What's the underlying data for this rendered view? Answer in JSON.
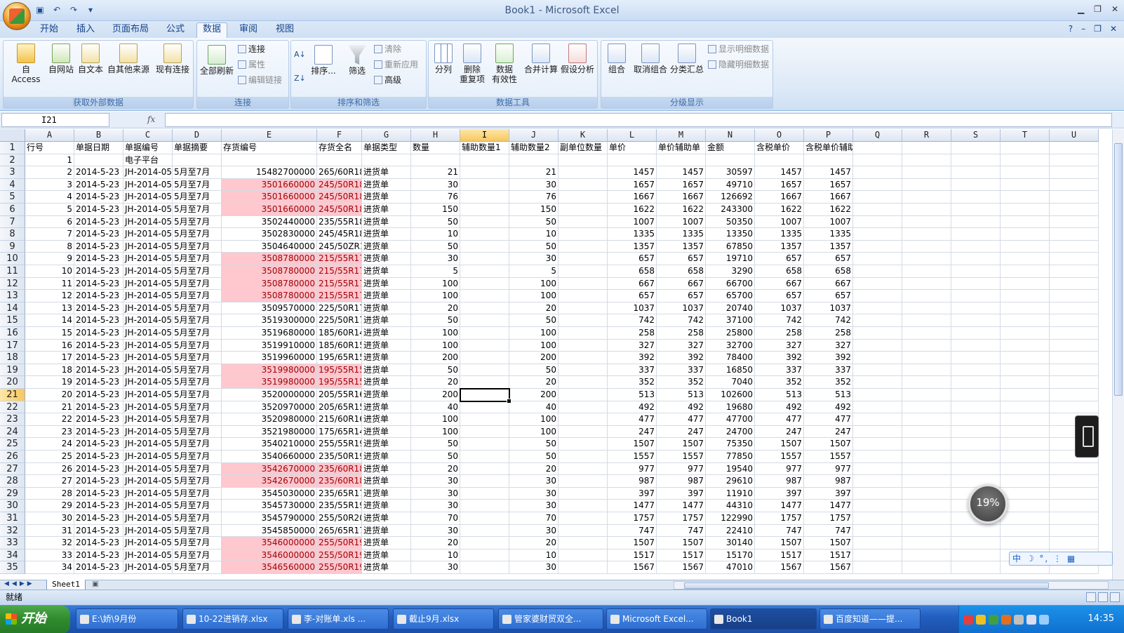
{
  "window": {
    "title": "Book1 - Microsoft Excel"
  },
  "menu": {
    "tabs": [
      "开始",
      "插入",
      "页面布局",
      "公式",
      "数据",
      "审阅",
      "视图"
    ],
    "active": "数据"
  },
  "ribbon": {
    "groups": {
      "external": "获取外部数据",
      "connections": "连接",
      "sort_filter": "排序和筛选",
      "data_tools": "数据工具",
      "outline": "分级显示"
    },
    "external": [
      "自 Access",
      "自网站",
      "自文本",
      "自其他来源",
      "现有连接"
    ],
    "refresh_all": "全部刷新",
    "conn_small": [
      "连接",
      "属性",
      "编辑链接"
    ],
    "sort": "排序...",
    "filter": "筛选",
    "filter_small": [
      "清除",
      "重新应用",
      "高级"
    ],
    "split": "分列",
    "remove_dup": [
      "删除",
      "重复项"
    ],
    "validation": [
      "数据",
      "有效性"
    ],
    "consolidate": "合并计算",
    "whatif": "假设分析",
    "group": "组合",
    "ungroup": "取消组合",
    "subtotal": "分类汇总",
    "outline_small": [
      "显示明细数据",
      "隐藏明细数据"
    ]
  },
  "formula": {
    "namebox": "I21",
    "fx": "fx",
    "value": ""
  },
  "columns": [
    "A",
    "B",
    "C",
    "D",
    "E",
    "F",
    "G",
    "H",
    "I",
    "J",
    "K",
    "L",
    "M",
    "N",
    "O",
    "P",
    "Q",
    "R",
    "S",
    "T",
    "U"
  ],
  "header_row": [
    "行号",
    "单据日期",
    "单据编号",
    "单据摘要",
    "存货编号",
    "存货全名",
    "单据类型",
    "数量",
    "辅助数量1",
    "辅助数量2",
    "副单位数量",
    "单价",
    "单价辅助单",
    "金额",
    "含税单价",
    "含税单价辅助单位"
  ],
  "row2": {
    "A": "1",
    "C": "电子平台"
  },
  "rows": [
    [
      "2",
      "15482700000",
      "265/60R18",
      "21",
      "21",
      "1457",
      "1457",
      "30597",
      "1457",
      "1457",
      false
    ],
    [
      "3",
      "3501660000",
      "245/50R18",
      "30",
      "30",
      "1657",
      "1657",
      "49710",
      "1657",
      "1657",
      true
    ],
    [
      "4",
      "3501660000",
      "245/50R18",
      "76",
      "76",
      "1667",
      "1667",
      "126692",
      "1667",
      "1667",
      true
    ],
    [
      "5",
      "3501660000",
      "245/50R18",
      "150",
      "150",
      "1622",
      "1622",
      "243300",
      "1622",
      "1622",
      true
    ],
    [
      "6",
      "3502440000",
      "235/55R18",
      "50",
      "50",
      "1007",
      "1007",
      "50350",
      "1007",
      "1007",
      false
    ],
    [
      "7",
      "3502830000",
      "245/45R18",
      "10",
      "10",
      "1335",
      "1335",
      "13350",
      "1335",
      "1335",
      false
    ],
    [
      "8",
      "3504640000",
      "245/50ZR1",
      "50",
      "50",
      "1357",
      "1357",
      "67850",
      "1357",
      "1357",
      false
    ],
    [
      "9",
      "3508780000",
      "215/55R17",
      "30",
      "30",
      "657",
      "657",
      "19710",
      "657",
      "657",
      true
    ],
    [
      "10",
      "3508780000",
      "215/55R17",
      "5",
      "5",
      "658",
      "658",
      "3290",
      "658",
      "658",
      true
    ],
    [
      "11",
      "3508780000",
      "215/55R17",
      "100",
      "100",
      "667",
      "667",
      "66700",
      "667",
      "667",
      true
    ],
    [
      "12",
      "3508780000",
      "215/55R17",
      "100",
      "100",
      "657",
      "657",
      "65700",
      "657",
      "657",
      true
    ],
    [
      "13",
      "3509570000",
      "225/50R17",
      "20",
      "20",
      "1037",
      "1037",
      "20740",
      "1037",
      "1037",
      false
    ],
    [
      "14",
      "3519300000",
      "225/50R17",
      "50",
      "50",
      "742",
      "742",
      "37100",
      "742",
      "742",
      false
    ],
    [
      "15",
      "3519680000",
      "185/60R14",
      "100",
      "100",
      "258",
      "258",
      "25800",
      "258",
      "258",
      false
    ],
    [
      "16",
      "3519910000",
      "185/60R15",
      "100",
      "100",
      "327",
      "327",
      "32700",
      "327",
      "327",
      false
    ],
    [
      "17",
      "3519960000",
      "195/65R15",
      "200",
      "200",
      "392",
      "392",
      "78400",
      "392",
      "392",
      false
    ],
    [
      "18",
      "3519980000",
      "195/55R15",
      "50",
      "50",
      "337",
      "337",
      "16850",
      "337",
      "337",
      true
    ],
    [
      "19",
      "3519980000",
      "195/55R15",
      "20",
      "20",
      "352",
      "352",
      "7040",
      "352",
      "352",
      true
    ],
    [
      "20",
      "3520000000",
      "205/55R16",
      "200",
      "200",
      "513",
      "513",
      "102600",
      "513",
      "513",
      false
    ],
    [
      "21",
      "3520970000",
      "205/65R15",
      "40",
      "40",
      "492",
      "492",
      "19680",
      "492",
      "492",
      false
    ],
    [
      "22",
      "3520980000",
      "215/60R16",
      "100",
      "100",
      "477",
      "477",
      "47700",
      "477",
      "477",
      false
    ],
    [
      "23",
      "3521980000",
      "175/65R14",
      "100",
      "100",
      "247",
      "247",
      "24700",
      "247",
      "247",
      false
    ],
    [
      "24",
      "3540210000",
      "255/55R19",
      "50",
      "50",
      "1507",
      "1507",
      "75350",
      "1507",
      "1507",
      false
    ],
    [
      "25",
      "3540660000",
      "235/50R19",
      "50",
      "50",
      "1557",
      "1557",
      "77850",
      "1557",
      "1557",
      false
    ],
    [
      "26",
      "3542670000",
      "235/60R18",
      "20",
      "20",
      "977",
      "977",
      "19540",
      "977",
      "977",
      true
    ],
    [
      "27",
      "3542670000",
      "235/60R18",
      "30",
      "30",
      "987",
      "987",
      "29610",
      "987",
      "987",
      true
    ],
    [
      "28",
      "3545030000",
      "235/65R17",
      "30",
      "30",
      "397",
      "397",
      "11910",
      "397",
      "397",
      false
    ],
    [
      "29",
      "3545730000",
      "235/55R19",
      "30",
      "30",
      "1477",
      "1477",
      "44310",
      "1477",
      "1477",
      false
    ],
    [
      "30",
      "3545790000",
      "255/50R20",
      "70",
      "70",
      "1757",
      "1757",
      "122990",
      "1757",
      "1757",
      false
    ],
    [
      "31",
      "3545850000",
      "265/65R17",
      "30",
      "30",
      "747",
      "747",
      "22410",
      "747",
      "747",
      false
    ],
    [
      "32",
      "3546000000",
      "255/50R19",
      "20",
      "20",
      "1507",
      "1507",
      "30140",
      "1507",
      "1507",
      true
    ],
    [
      "33",
      "3546000000",
      "255/50R19",
      "10",
      "10",
      "1517",
      "1517",
      "15170",
      "1517",
      "1517",
      true
    ],
    [
      "34",
      "3546560000",
      "255/50R19",
      "30",
      "30",
      "1567",
      "1567",
      "47010",
      "1567",
      "1567",
      true
    ]
  ],
  "common": {
    "date": "2014-5-23",
    "docno": "JH-2014-05-",
    "summary": "5月至7月",
    "doctype": "进货单"
  },
  "sheet": {
    "tab": "Sheet1"
  },
  "status": {
    "text": "就绪"
  },
  "taskbar": {
    "start": "开始",
    "items": [
      "E:\\娇\\9月份",
      "10-22进销存.xlsx",
      "李-对账单.xls  ...",
      "截止9月.xlsx",
      "管家婆财贸双全...",
      "Microsoft Excel...",
      "Book1",
      "百度知道——提..."
    ],
    "clock": "14:35"
  },
  "widgets": {
    "percent": "19%",
    "ime": "中 ☽ °, ⋮ ▦"
  },
  "colors": {
    "pink_fill": "#ffc7ce",
    "pink_text": "#9c0006",
    "ribbon_blue": "#dde9f7",
    "taskbar": "#225fc0"
  }
}
